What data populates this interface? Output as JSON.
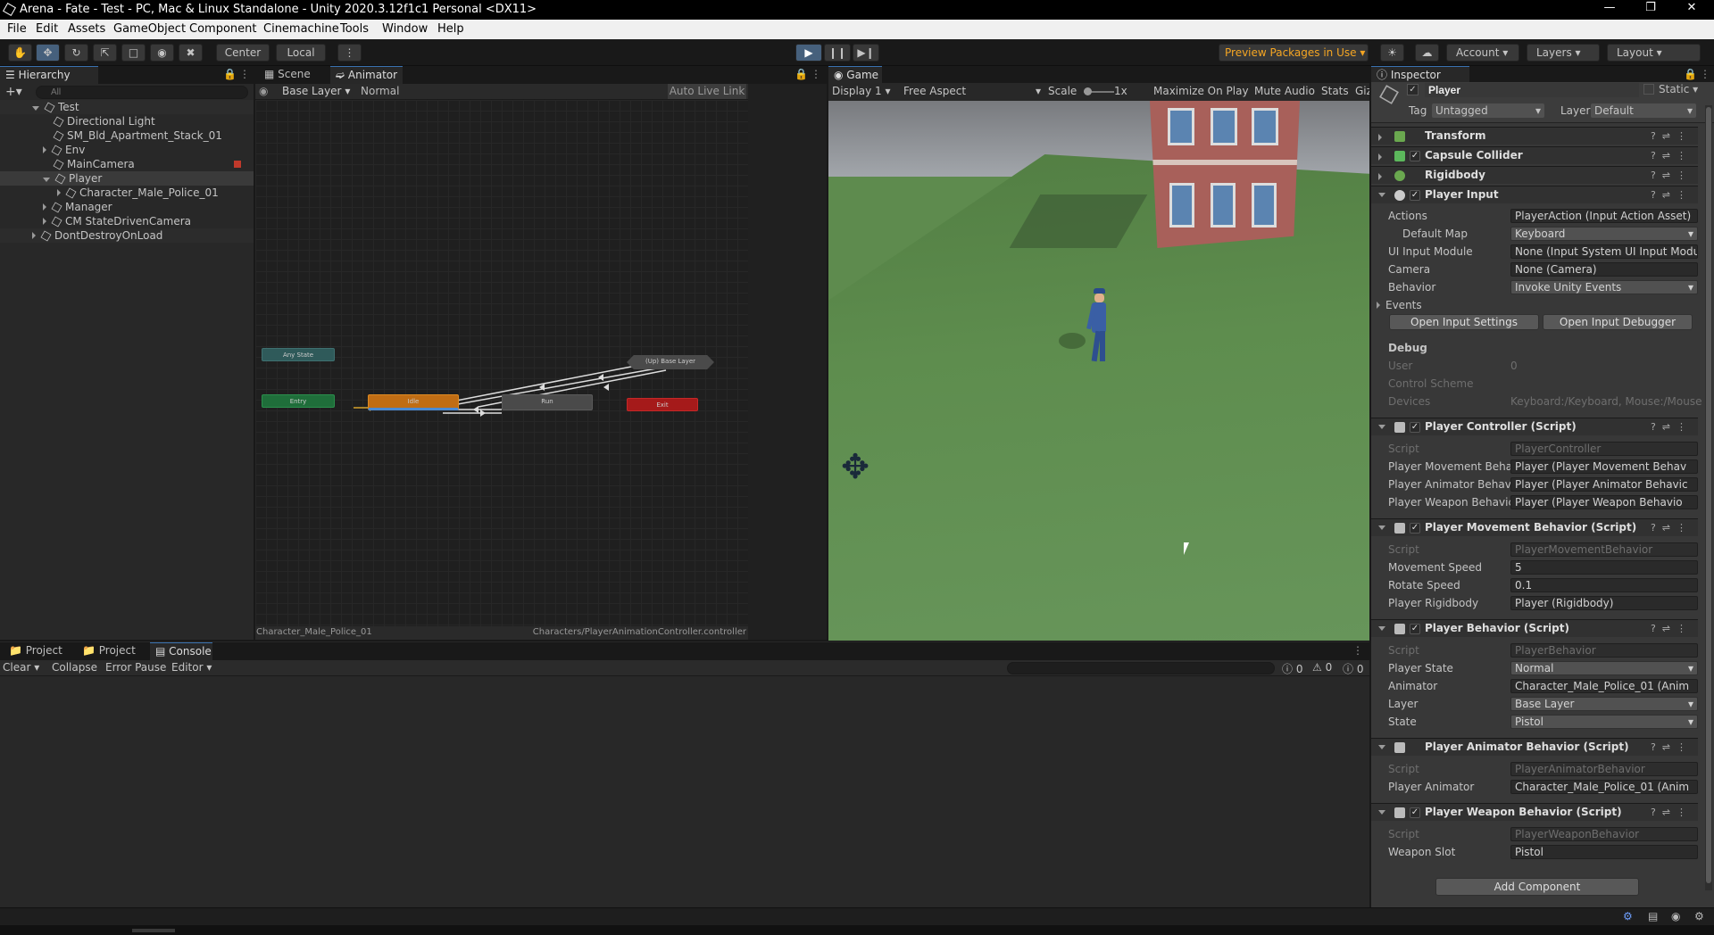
{
  "window": {
    "title": "Arena - Fate - Test - PC, Mac & Linux Standalone - Unity 2020.3.12f1c1 Personal <DX11>"
  },
  "menu": [
    "File",
    "Edit",
    "Assets",
    "GameObject",
    "Component",
    "Cinemachine",
    "Tools",
    "Window",
    "Help"
  ],
  "toolbar": {
    "pivot": "Center",
    "space": "Local",
    "preview": "Preview Packages in Use",
    "account": "Account",
    "layers": "Layers",
    "layout": "Layout"
  },
  "hierarchy": {
    "tab": "Hierarchy",
    "search_placeholder": "All",
    "items": [
      {
        "label": "Test",
        "depth": 0
      },
      {
        "label": "Directional Light",
        "depth": 1
      },
      {
        "label": "SM_Bld_Apartment_Stack_01",
        "depth": 1
      },
      {
        "label": "Env",
        "depth": 1
      },
      {
        "label": "MainCamera",
        "depth": 1
      },
      {
        "label": "Player",
        "depth": 1
      },
      {
        "label": "Character_Male_Police_01",
        "depth": 2
      },
      {
        "label": "Manager",
        "depth": 1
      },
      {
        "label": "CM StateDrivenCamera",
        "depth": 1
      },
      {
        "label": "DontDestroyOnLoad",
        "depth": 0
      }
    ]
  },
  "animator": {
    "tab_scene": "Scene",
    "tab_animator": "Animator",
    "layer": "Base Layer",
    "mode": "Normal",
    "auto_live": "Auto Live Link",
    "footer_left": "Character_Male_Police_01",
    "footer_right": "Characters/PlayerAnimationController.controller",
    "nodes": {
      "any": "Any State",
      "entry": "Entry",
      "idle": "Idle",
      "run": "Run",
      "exit": "Exit",
      "up": "(Up) Base Layer"
    }
  },
  "game": {
    "tab": "Game",
    "display": "Display 1",
    "aspect": "Free Aspect",
    "scale_label": "Scale",
    "scale_value": "1x",
    "maximize": "Maximize On Play",
    "mute": "Mute Audio",
    "stats": "Stats",
    "gizmos": "Giz"
  },
  "inspector": {
    "tab": "Inspector",
    "object": "Player",
    "static": "Static",
    "tag_label": "Tag",
    "tag": "Untagged",
    "layer_label": "Layer",
    "layer": "Default",
    "comps": {
      "transform": "Transform",
      "capsule": "Capsule Collider",
      "rigidbody": "Rigidbody",
      "player_input": "Player Input",
      "controller": "Player Controller (Script)",
      "movement": "Player Movement Behavior (Script)",
      "behavior": "Player Behavior (Script)",
      "anim_beh": "Player Animator Behavior (Script)",
      "weapon": "Player Weapon Behavior (Script)"
    },
    "pi": {
      "actions_l": "Actions",
      "actions_v": "PlayerAction (Input Action Asset)",
      "map_l": "Default Map",
      "map_v": "Keyboard",
      "ui_l": "UI Input Module",
      "ui_v": "None (Input System UI Input Modu",
      "cam_l": "Camera",
      "cam_v": "None (Camera)",
      "beh_l": "Behavior",
      "beh_v": "Invoke Unity Events",
      "events": "Events",
      "open_settings": "Open Input Settings",
      "open_debugger": "Open Input Debugger",
      "debug": "Debug",
      "user_l": "User",
      "user_v": "0",
      "scheme_l": "Control Scheme",
      "devices_l": "Devices",
      "devices_v": "Keyboard:/Keyboard, Mouse:/Mouse"
    },
    "pc": {
      "script_l": "Script",
      "script_v": "PlayerController",
      "mov_l": "Player Movement Beha",
      "mov_v": "Player (Player Movement Behav",
      "anim_l": "Player Animator Behavi",
      "anim_v": "Player (Player Animator Behavic",
      "weap_l": "Player Weapon Behavic",
      "weap_v": "Player (Player Weapon Behavio"
    },
    "pm": {
      "script_l": "Script",
      "script_v": "PlayerMovementBehavior",
      "speed_l": "Movement Speed",
      "speed_v": "5",
      "rot_l": "Rotate Speed",
      "rot_v": "0.1",
      "rb_l": "Player Rigidbody",
      "rb_v": "Player (Rigidbody)"
    },
    "pb": {
      "script_l": "Script",
      "script_v": "PlayerBehavior",
      "state_l": "Player State",
      "state_v": "Normal",
      "anim_l": "Animator",
      "anim_v": "Character_Male_Police_01 (Anim",
      "layer_l": "Layer",
      "layer_v": "Base Layer",
      "st_l": "State",
      "st_v": "Pistol"
    },
    "pa": {
      "script_l": "Script",
      "script_v": "PlayerAnimatorBehavior",
      "anim_l": "Player Animator",
      "anim_v": "Character_Male_Police_01 (Anim"
    },
    "pw": {
      "script_l": "Script",
      "script_v": "PlayerWeaponBehavior",
      "slot_l": "Weapon Slot",
      "slot_v": "Pistol"
    },
    "add_component": "Add Component"
  },
  "console": {
    "tabs": [
      "Project",
      "Project",
      "Console"
    ],
    "clear": "Clear",
    "collapse": "Collapse",
    "error_pause": "Error Pause",
    "editor": "Editor",
    "counts": [
      "0",
      "0",
      "0"
    ]
  }
}
